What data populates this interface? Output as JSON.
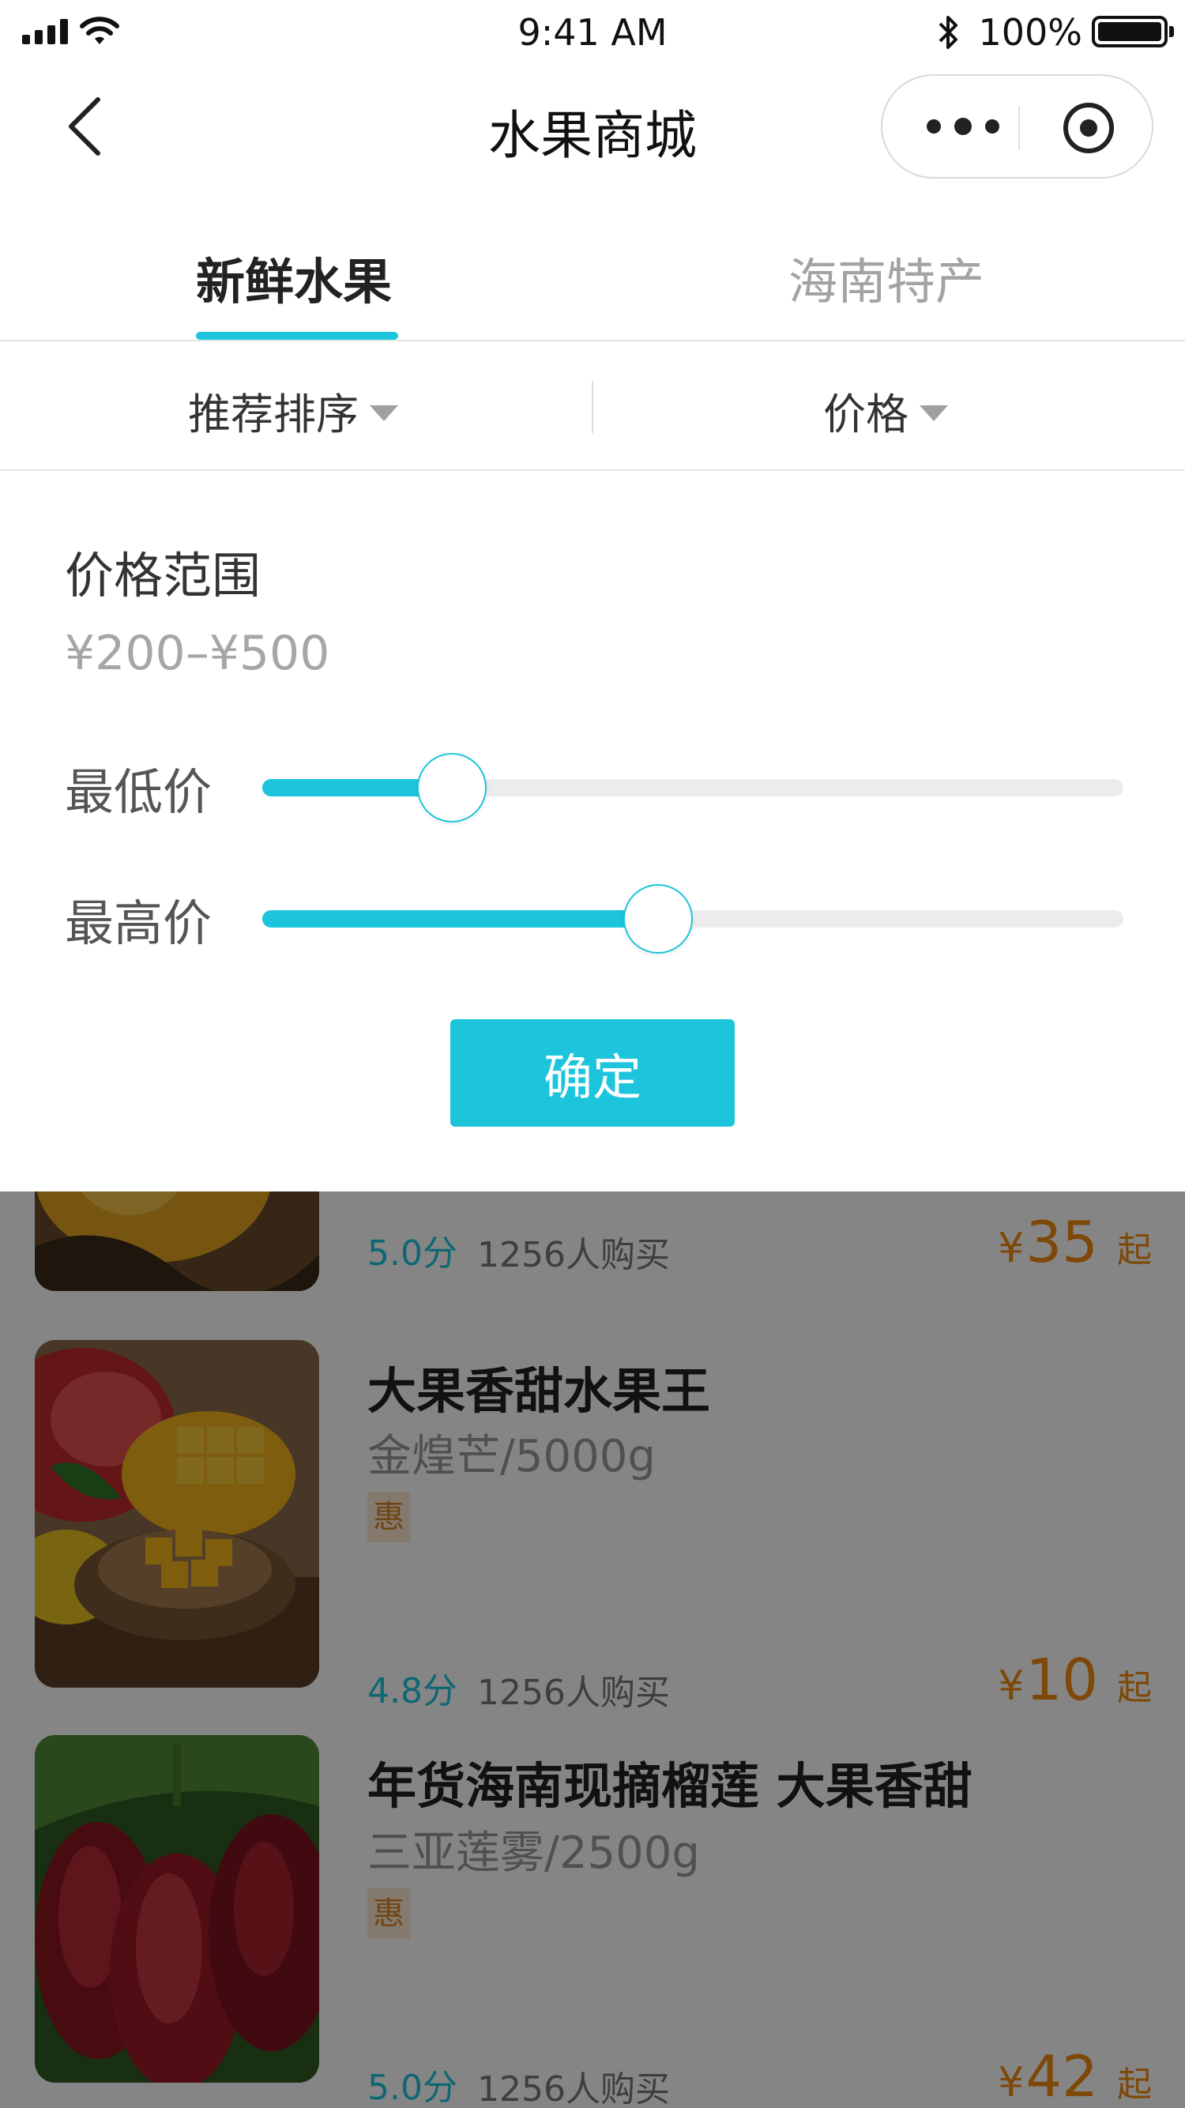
{
  "status_bar": {
    "time": "9:41 AM",
    "battery": "100%"
  },
  "nav": {
    "title": "水果商城",
    "icons": [
      "back-icon",
      "more-icon",
      "target-icon"
    ]
  },
  "tabs": [
    {
      "label": "新鲜水果",
      "active": true
    },
    {
      "label": "海南特产",
      "active": false
    }
  ],
  "filters": {
    "sort_label": "推荐排序",
    "price_label": "价格"
  },
  "price_panel": {
    "title": "价格范围",
    "range_text": "¥200–¥500",
    "min_label": "最低价",
    "max_label": "最高价",
    "min_level": 0.22,
    "max_level": 0.46,
    "confirm_label": "确定"
  },
  "products": [
    {
      "name": "",
      "spec": "",
      "tag": "",
      "rating": "5.0分",
      "buyers": "1256人购买",
      "price_currency": "¥",
      "price": "35",
      "price_suffix": "起",
      "image": "yellow-fruit"
    },
    {
      "name": "大果香甜水果王",
      "spec": "金煌芒/5000g",
      "tag": "惠",
      "rating": "4.8分",
      "buyers": "1256人购买",
      "price_currency": "¥",
      "price": "10",
      "price_suffix": "起",
      "image": "mango"
    },
    {
      "name": "年货海南现摘榴莲 大果香甜",
      "spec": "三亚莲雾/2500g",
      "tag": "惠",
      "rating": "5.0分",
      "buyers": "1256人购买",
      "price_currency": "¥",
      "price": "42",
      "price_suffix": "起",
      "image": "wax-apple"
    }
  ],
  "colors": {
    "accent": "#1cc5dc",
    "price": "#f28a10",
    "tag_bg": "#fde9d2"
  }
}
